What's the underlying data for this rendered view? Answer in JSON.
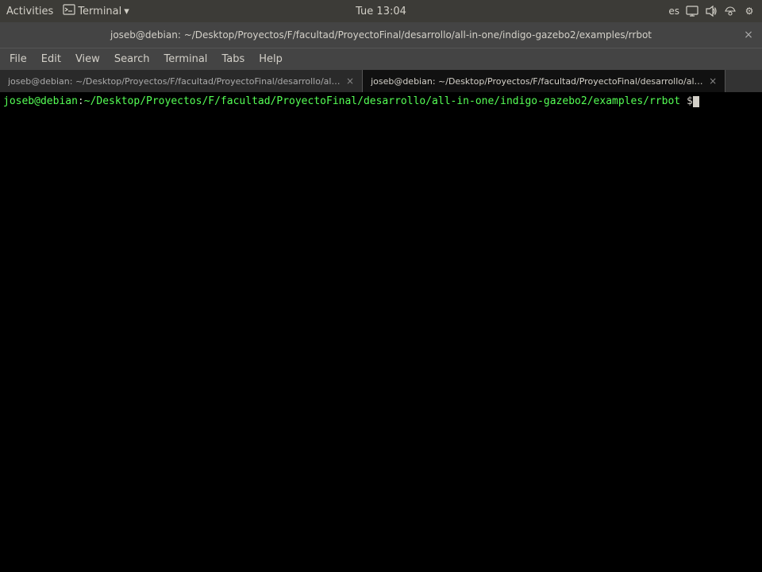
{
  "system_bar": {
    "activities": "Activities",
    "terminal_app": "Terminal",
    "time": "Tue 13:04",
    "lang": "es",
    "chevron": "▾"
  },
  "title_bar": {
    "title": "joseb@debian: ~/Desktop/Proyectos/F/facultad/ProyectoFinal/desarrollo/all-in-one/indigo-gazebo2/examples/rrbot",
    "close_label": "×"
  },
  "menu_bar": {
    "items": [
      "File",
      "Edit",
      "View",
      "Search",
      "Terminal",
      "Tabs",
      "Help"
    ]
  },
  "tabs": [
    {
      "label": "joseb@debian: ~/Desktop/Proyectos/F/facultad/ProyectoFinal/desarrollo/all-in-one/indigo...",
      "active": false,
      "close": "×"
    },
    {
      "label": "joseb@debian: ~/Desktop/Proyectos/F/facultad/ProyectoFinal/desarrollo/all-in-one/indigo...",
      "active": true,
      "close": "×"
    }
  ],
  "terminal": {
    "prompt_user": "joseb@debian",
    "prompt_sep": ":",
    "prompt_path": "~/Desktop/Proyectos/F/facultad/ProyectoFinal/desarrollo/all-in-one/indigo-gazebo2/examples/rrbot",
    "prompt_dollar": "$"
  }
}
